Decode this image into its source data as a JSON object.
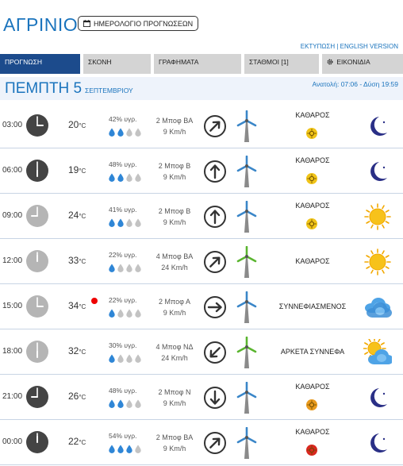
{
  "header": {
    "city": "ΑΓΡΙΝΙΟ",
    "calendar_button": "ΗΜΕΡΟΛΟΓΙΟ ΠΡΟΓΝΩΣΕΩΝ",
    "print_links": "ΕΚΤΥΠΩΣΗ | ENGLISH VERSION"
  },
  "tabs": [
    {
      "label": "ΠΡΟΓΝΩΣΗ",
      "active": true
    },
    {
      "label": "ΣΚΟΝΗ",
      "active": false
    },
    {
      "label": "ΓΡΑΦΗΜΑΤΑ",
      "active": false
    },
    {
      "label": "ΣΤΑΘΜΟΙ [1]",
      "active": false
    },
    {
      "label": "ΕΙΚΟΝΙΔΙΑ",
      "active": false
    }
  ],
  "day": {
    "name": "ΠΕΜΠΤΗ 5",
    "month": "ΣΕΠΤΕΜΒΡΙΟΥ",
    "sun": "Ανατολή: 07:06 - Δύση 19:59"
  },
  "colors": {
    "brand_blue": "#1b74bd",
    "tab_active": "#1c4b8c",
    "tab_inactive": "#d4d4d4",
    "drop_filled": "#2f86d6",
    "drop_empty": "#c3c3c3",
    "turbine_green": "#5ab52f",
    "turbine_blue": "#3a86c8",
    "uv_yellow": "#f0c419",
    "uv_orange": "#e89a1e",
    "uv_red": "#d9281f"
  },
  "rows": [
    {
      "time": "03:00",
      "night": true,
      "temp": "20",
      "unit": "°C",
      "hot": false,
      "humidity": "42% υγρ.",
      "drops": 2,
      "wind_force": "2 Μποφ ΒΑ",
      "wind_speed": "9 Km/h",
      "dir_deg": 45,
      "turbine": "blue",
      "sky": "ΚΑΘΑΡΟΣ",
      "uv": "yellow",
      "icon": "moon"
    },
    {
      "time": "06:00",
      "night": true,
      "temp": "19",
      "unit": "°C",
      "hot": false,
      "humidity": "48% υγρ.",
      "drops": 2,
      "wind_force": "2 Μποφ Β",
      "wind_speed": "9 Km/h",
      "dir_deg": 0,
      "turbine": "blue",
      "sky": "ΚΑΘΑΡΟΣ",
      "uv": "yellow",
      "icon": "moon"
    },
    {
      "time": "09:00",
      "night": false,
      "temp": "24",
      "unit": "°C",
      "hot": false,
      "humidity": "41% υγρ.",
      "drops": 2,
      "wind_force": "2 Μποφ Β",
      "wind_speed": "9 Km/h",
      "dir_deg": 0,
      "turbine": "blue",
      "sky": "ΚΑΘΑΡΟΣ",
      "uv": "yellow",
      "icon": "sun"
    },
    {
      "time": "12:00",
      "night": false,
      "temp": "33",
      "unit": "°C",
      "hot": false,
      "humidity": "22% υγρ.",
      "drops": 1,
      "wind_force": "4 Μποφ ΒΑ",
      "wind_speed": "24 Km/h",
      "dir_deg": 45,
      "turbine": "green",
      "sky": "ΚΑΘΑΡΟΣ",
      "uv": "none",
      "icon": "sun"
    },
    {
      "time": "15:00",
      "night": false,
      "temp": "34",
      "unit": "°C",
      "hot": true,
      "humidity": "22% υγρ.",
      "drops": 1,
      "wind_force": "2 Μποφ Α",
      "wind_speed": "9 Km/h",
      "dir_deg": 90,
      "turbine": "blue",
      "sky": "ΣΥΝΝΕΦΙΑΣΜΕΝΟΣ",
      "uv": "none",
      "icon": "cloud"
    },
    {
      "time": "18:00",
      "night": false,
      "temp": "32",
      "unit": "°C",
      "hot": false,
      "humidity": "30% υγρ.",
      "drops": 1,
      "wind_force": "4 Μποφ ΝΔ",
      "wind_speed": "24 Km/h",
      "dir_deg": 225,
      "turbine": "green",
      "sky": "ΑΡΚΕΤΑ ΣΥΝΝΕΦΑ",
      "uv": "none",
      "icon": "sun-cloud"
    },
    {
      "time": "21:00",
      "night": true,
      "temp": "26",
      "unit": "°C",
      "hot": false,
      "humidity": "48% υγρ.",
      "drops": 2,
      "wind_force": "2 Μποφ Ν",
      "wind_speed": "9 Km/h",
      "dir_deg": 180,
      "turbine": "blue",
      "sky": "ΚΑΘΑΡΟΣ",
      "uv": "orange",
      "icon": "moon"
    },
    {
      "time": "00:00",
      "night": true,
      "temp": "22",
      "unit": "°C",
      "hot": false,
      "humidity": "54% υγρ.",
      "drops": 3,
      "wind_force": "2 Μποφ ΒΑ",
      "wind_speed": "9 Km/h",
      "dir_deg": 45,
      "turbine": "blue",
      "sky": "ΚΑΘΑΡΟΣ",
      "uv": "red",
      "icon": "moon"
    }
  ]
}
